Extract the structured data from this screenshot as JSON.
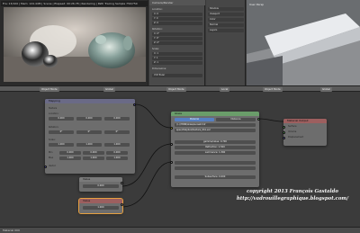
{
  "render": {
    "info": "Fra: 13/100 | Mem: 124.44M | Scene | Elapsed: 00:26.78 | Rendering | Path Tracing Sample 750/750"
  },
  "props": {
    "header": "Camera/Render",
    "labels": [
      "Location:",
      "Rotation:",
      "Scale:",
      "Dimensions:"
    ],
    "values": [
      "X: 0",
      "Y: 0",
      "Z: 0",
      "X: 0°",
      "Y: 0°",
      "Z: 0°",
      "X: 1",
      "Y: 1",
      "Z: 1"
    ],
    "footer": "XYZ Euler"
  },
  "material": {
    "rows": [
      "Shadow",
      "Viewport",
      "Color",
      "Normal",
      "Layers"
    ]
  },
  "viewport": {
    "label": "User Persp"
  },
  "header_bar": {
    "items": [
      "Object Mode",
      "Global",
      "Object Mode",
      "Local",
      "Object Mode",
      "Global"
    ]
  },
  "nodes": {
    "mapping": {
      "title": "Mapping",
      "rows": [
        "Texture",
        "Location:",
        "Rotation:",
        "Scale:",
        "Min",
        "Max"
      ],
      "loc": [
        "0.000",
        "0.000",
        "0.000"
      ],
      "rot": [
        "0°",
        "0°",
        "0°"
      ],
      "scale": [
        "1.000",
        "1.000",
        "1.000"
      ],
      "minmax": [
        "0.000",
        "0.000",
        "0.000",
        "1.000",
        "1.000",
        "1.000"
      ],
      "footer": "Vector"
    },
    "value1": {
      "title": "Value",
      "value": "0.000"
    },
    "value2": {
      "title": "Value",
      "value": "1.000"
    },
    "principled": {
      "title": "Glass",
      "tabs": [
        "Material",
        "Distance"
      ],
      "file": "//..//HDRI/skies/sunset.hdr",
      "sub": "spec/ASkybox/texture_01b.exr",
      "params": [
        "gamma/value: 0.700",
        "Refraction: 1.500",
        "Luminance: 1.390",
        "",
        "",
        "Subsurface: 0.000"
      ]
    },
    "output": {
      "title": "Material Output",
      "rows": [
        "Surface",
        "Volume",
        "Displacement"
      ]
    }
  },
  "copyright": {
    "line1": "copyright 2013 François Gastaldo",
    "line2": "http://vadrouillegraphique.blogspot.com/"
  },
  "footer": {
    "label": "Material 000"
  },
  "colors": {
    "accent": "#5680c2",
    "node_header_output": "#9d5f5f",
    "socket_yellow": "#c7c729",
    "socket_grey": "#a0a0a0",
    "socket_purple": "#6363c7",
    "socket_green": "#63c763"
  }
}
